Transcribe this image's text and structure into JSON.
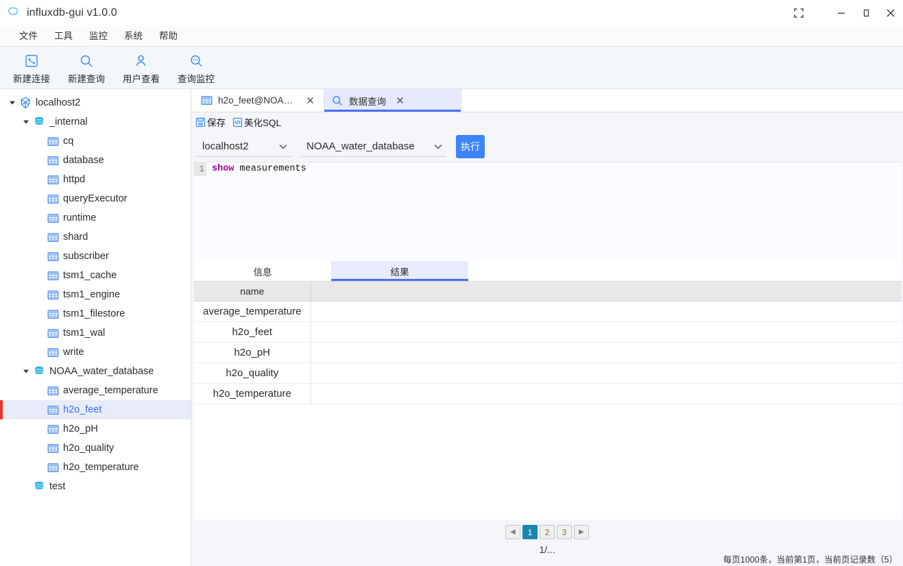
{
  "window": {
    "title": "influxdb-gui v1.0.0",
    "app_icon": "cloud-icon",
    "controls": [
      {
        "name": "fullscreen-button",
        "icon": "fullscreen-icon"
      },
      {
        "name": "minimize-button",
        "icon": "minimize-icon"
      },
      {
        "name": "maximize-button",
        "icon": "maximize-icon"
      },
      {
        "name": "close-button",
        "icon": "close-icon"
      }
    ]
  },
  "menubar": {
    "items": [
      {
        "label": "文件"
      },
      {
        "label": "工具"
      },
      {
        "label": "监控"
      },
      {
        "label": "系统"
      },
      {
        "label": "帮助"
      }
    ]
  },
  "toolbar": {
    "items": [
      {
        "label": "新建连接",
        "icon": "new-connection-icon"
      },
      {
        "label": "新建查询",
        "icon": "search-icon"
      },
      {
        "label": "用户查看",
        "icon": "user-icon"
      },
      {
        "label": "查询监控",
        "icon": "monitor-icon"
      }
    ]
  },
  "sidebar": {
    "nodes": [
      {
        "label": "localhost2",
        "icon": "server-icon",
        "depth": 0,
        "expanded": true,
        "selected": false
      },
      {
        "label": "_internal",
        "icon": "database-icon",
        "depth": 1,
        "expanded": true,
        "selected": false
      },
      {
        "label": "cq",
        "icon": "table-icon",
        "depth": 2,
        "expanded": null,
        "selected": false
      },
      {
        "label": "database",
        "icon": "table-icon",
        "depth": 2,
        "expanded": null,
        "selected": false
      },
      {
        "label": "httpd",
        "icon": "table-icon",
        "depth": 2,
        "expanded": null,
        "selected": false
      },
      {
        "label": "queryExecutor",
        "icon": "table-icon",
        "depth": 2,
        "expanded": null,
        "selected": false
      },
      {
        "label": "runtime",
        "icon": "table-icon",
        "depth": 2,
        "expanded": null,
        "selected": false
      },
      {
        "label": "shard",
        "icon": "table-icon",
        "depth": 2,
        "expanded": null,
        "selected": false
      },
      {
        "label": "subscriber",
        "icon": "table-icon",
        "depth": 2,
        "expanded": null,
        "selected": false
      },
      {
        "label": "tsm1_cache",
        "icon": "table-icon",
        "depth": 2,
        "expanded": null,
        "selected": false
      },
      {
        "label": "tsm1_engine",
        "icon": "table-icon",
        "depth": 2,
        "expanded": null,
        "selected": false
      },
      {
        "label": "tsm1_filestore",
        "icon": "table-icon",
        "depth": 2,
        "expanded": null,
        "selected": false
      },
      {
        "label": "tsm1_wal",
        "icon": "table-icon",
        "depth": 2,
        "expanded": null,
        "selected": false
      },
      {
        "label": "write",
        "icon": "table-icon",
        "depth": 2,
        "expanded": null,
        "selected": false
      },
      {
        "label": "NOAA_water_database",
        "icon": "database-icon",
        "depth": 1,
        "expanded": true,
        "selected": false
      },
      {
        "label": "average_temperature",
        "icon": "table-icon",
        "depth": 2,
        "expanded": null,
        "selected": false
      },
      {
        "label": "h2o_feet",
        "icon": "table-icon",
        "depth": 2,
        "expanded": null,
        "selected": true
      },
      {
        "label": "h2o_pH",
        "icon": "table-icon",
        "depth": 2,
        "expanded": null,
        "selected": false
      },
      {
        "label": "h2o_quality",
        "icon": "table-icon",
        "depth": 2,
        "expanded": null,
        "selected": false
      },
      {
        "label": "h2o_temperature",
        "icon": "table-icon",
        "depth": 2,
        "expanded": null,
        "selected": false
      },
      {
        "label": "test",
        "icon": "database-icon",
        "depth": 1,
        "expanded": null,
        "selected": false
      }
    ]
  },
  "tabs": [
    {
      "label": "h2o_feet@NOAA_w...",
      "icon": "table-icon",
      "active": false,
      "close": "×"
    },
    {
      "label": "数据查询",
      "icon": "search-icon",
      "active": true,
      "close": "×"
    }
  ],
  "editor_tools": [
    {
      "label": "保存",
      "icon": "save-icon"
    },
    {
      "label": "美化SQL",
      "icon": "code-format-icon"
    }
  ],
  "query": {
    "connection": "localhost2",
    "database": "NOAA_water_database",
    "execute_label": "执行",
    "line_number": "1",
    "keyword": "show",
    "rest": " measurements"
  },
  "result_tabs": [
    {
      "label": "信息",
      "active": false
    },
    {
      "label": "结果",
      "active": true
    }
  ],
  "result_table": {
    "columns": [
      "name"
    ],
    "rows": [
      [
        "average_temperature"
      ],
      [
        "h2o_feet"
      ],
      [
        "h2o_pH"
      ],
      [
        "h2o_quality"
      ],
      [
        "h2o_temperature"
      ]
    ]
  },
  "pager": {
    "prev": "◀",
    "next": "▶",
    "pages": [
      "1",
      "2",
      "3"
    ],
    "current": "1",
    "info": "1/..."
  },
  "statusbar": {
    "text": "每页1000条，当前第1页，当前页记录数（5）"
  },
  "colors": {
    "accent_blue": "#3d84f7",
    "tab_active_bg": "#e5eaff",
    "tab_active_border": "#4a6ef5",
    "tree_selected_bg": "#e8ecfa",
    "tree_selected_bar": "#e8342a",
    "pager_active": "#1787b0",
    "keyword": "#a7009b",
    "icon_blue": "#3d8ef0"
  }
}
